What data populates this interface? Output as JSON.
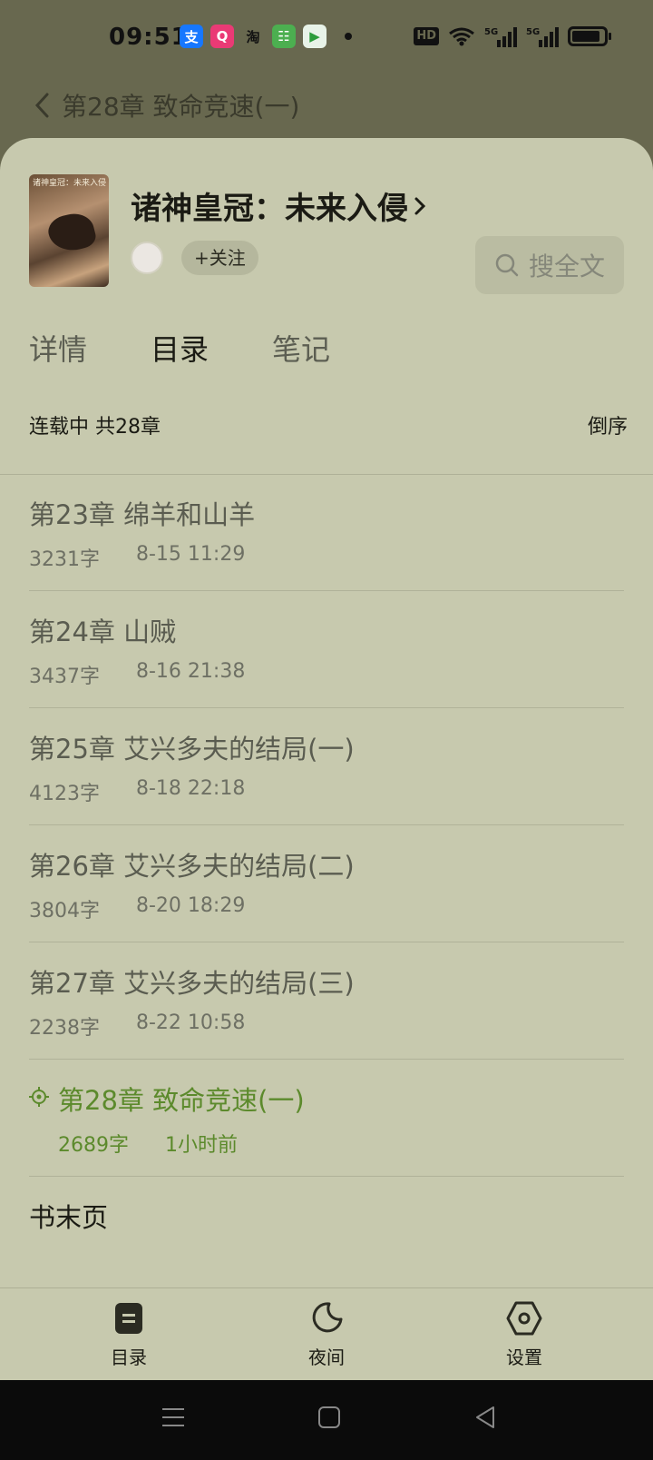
{
  "status_bar": {
    "time": "09:51",
    "apps": [
      {
        "name": "alipay-icon",
        "glyph": "支",
        "color": "#1677ff"
      },
      {
        "name": "app-pink-icon",
        "glyph": "Q",
        "color": "#ea3a75"
      },
      {
        "name": "taobao-icon",
        "glyph": "淘",
        "color": "#68684f"
      },
      {
        "name": "app-green-icon",
        "glyph": "☷",
        "color": "#4caf50"
      },
      {
        "name": "video-app-icon",
        "glyph": "▶",
        "color": "#e8f3e8"
      }
    ],
    "hd_label": "HD",
    "net_labels": [
      "5G",
      "5G"
    ]
  },
  "header": {
    "chapter_title": "第28章 致命竞速(一)"
  },
  "book": {
    "cover_text": "诸神皇冠：未来入侵",
    "title": "诸神皇冠：未来入侵",
    "follow_label": "+关注",
    "search_label": "搜全文"
  },
  "tabs": [
    {
      "label": "详情",
      "active": false
    },
    {
      "label": "目录",
      "active": true
    },
    {
      "label": "笔记",
      "active": false
    }
  ],
  "list_meta": {
    "status": "连载中 共28章",
    "sort_label": "倒序"
  },
  "chapters": [
    {
      "title": "第23章 绵羊和山羊",
      "words": "3231字",
      "date": "8-15 11:29"
    },
    {
      "title": "第24章 山贼",
      "words": "3437字",
      "date": "8-16 21:38"
    },
    {
      "title": "第25章 艾兴多夫的结局(一)",
      "words": "4123字",
      "date": "8-18 22:18"
    },
    {
      "title": "第26章 艾兴多夫的结局(二)",
      "words": "3804字",
      "date": "8-20 18:29"
    },
    {
      "title": "第27章 艾兴多夫的结局(三)",
      "words": "2238字",
      "date": "8-22 10:58"
    },
    {
      "title": "第28章 致命竞速(一)",
      "words": "2689字",
      "date": "1小时前",
      "current": true
    }
  ],
  "end_page_label": "书末页",
  "bottom_bar": [
    {
      "label": "目录",
      "icon": "toc-icon"
    },
    {
      "label": "夜间",
      "icon": "moon-icon"
    },
    {
      "label": "设置",
      "icon": "settings-icon"
    }
  ],
  "colors": {
    "sheet_bg": "#c7c9ae",
    "accent_green": "#5c8a2c",
    "overlay": "#68684f"
  }
}
